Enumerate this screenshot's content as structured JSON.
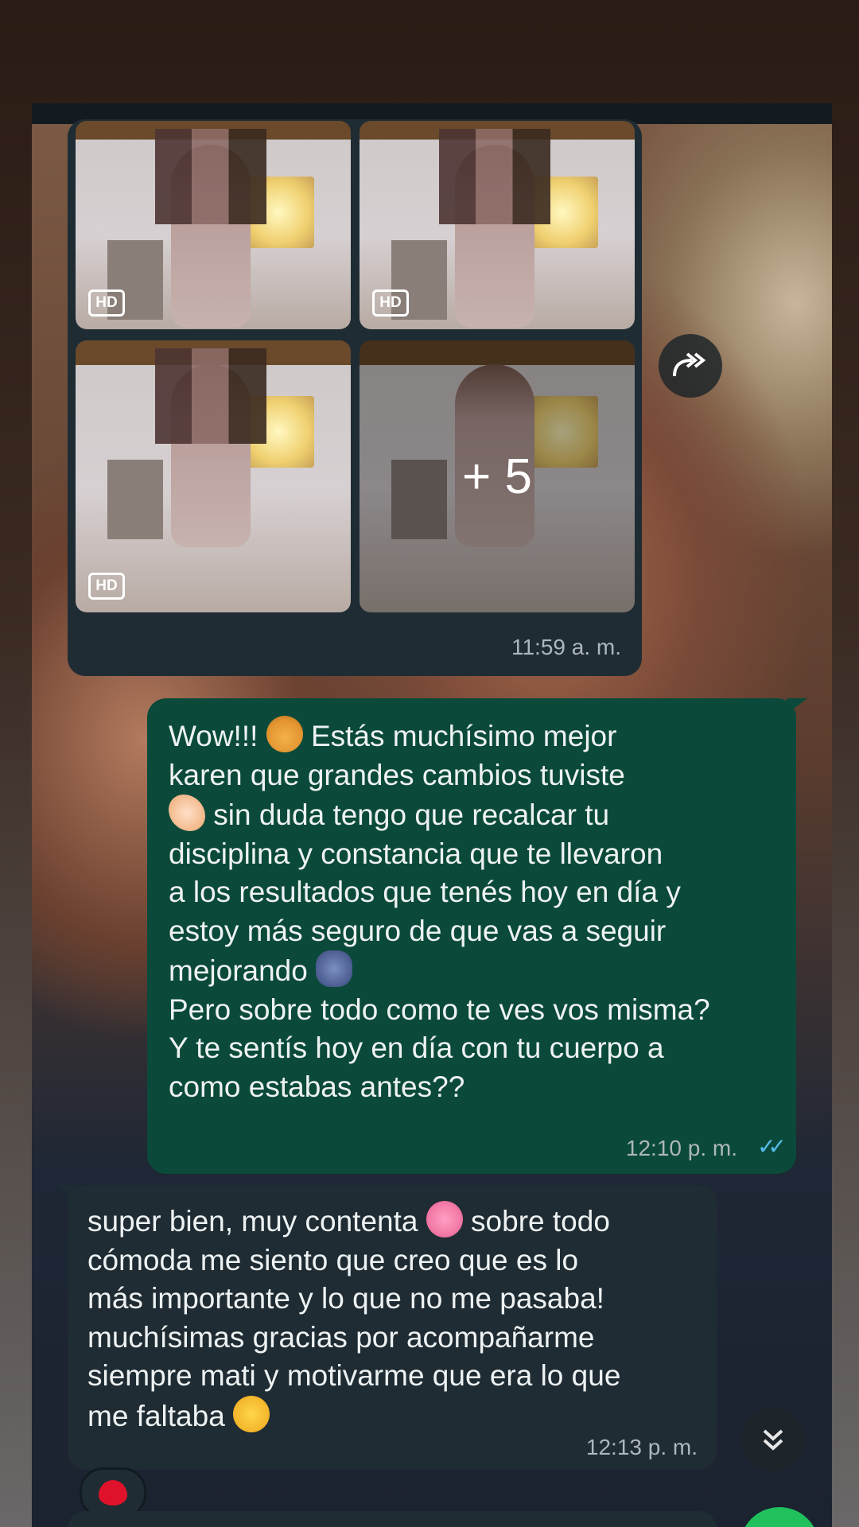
{
  "media_message": {
    "tiles": [
      {
        "badge": "HD"
      },
      {
        "badge": "HD"
      },
      {
        "badge": "HD"
      },
      {
        "overlay": "+ 5"
      }
    ],
    "time": "11:59 a. m."
  },
  "outgoing_message": {
    "line1": "Wow!!! ",
    "line1b": " Estás muchísimo mejor",
    "line2": "karen que grandes cambios tuviste",
    "line3": " sin duda tengo que recalcar tu",
    "line4": "disciplina y constancia que te llevaron",
    "line5": "a los resultados que tenés hoy en día y",
    "line6": "estoy más seguro de que vas a seguir",
    "line7": "mejorando ",
    "line8": "Pero sobre todo como te ves vos misma?",
    "line9": "Y te sentís hoy en día con tu cuerpo a",
    "line10": "como estabas antes??",
    "time": "12:10 p. m.",
    "status": "read"
  },
  "incoming_message": {
    "line1": "super bien, muy contenta ",
    "line1b": " sobre todo",
    "line2": "cómoda me siento que creo que es lo",
    "line3": "más importante y lo que no me pasaba!",
    "line4": "muchísimas gracias por acompañarme",
    "line5": "siempre mati y motivarme que era lo que",
    "line6": "me faltaba ",
    "time": "12:13 p. m.",
    "reaction": "red-heart"
  },
  "icons": {
    "forward": "forward-icon",
    "scroll_down": "double-chevron-down-icon"
  },
  "colors": {
    "incoming_bubble": "#1f2c33",
    "outgoing_bubble": "#0b4a3a",
    "read_ticks": "#53bdeb",
    "fab": "#20c05d"
  }
}
